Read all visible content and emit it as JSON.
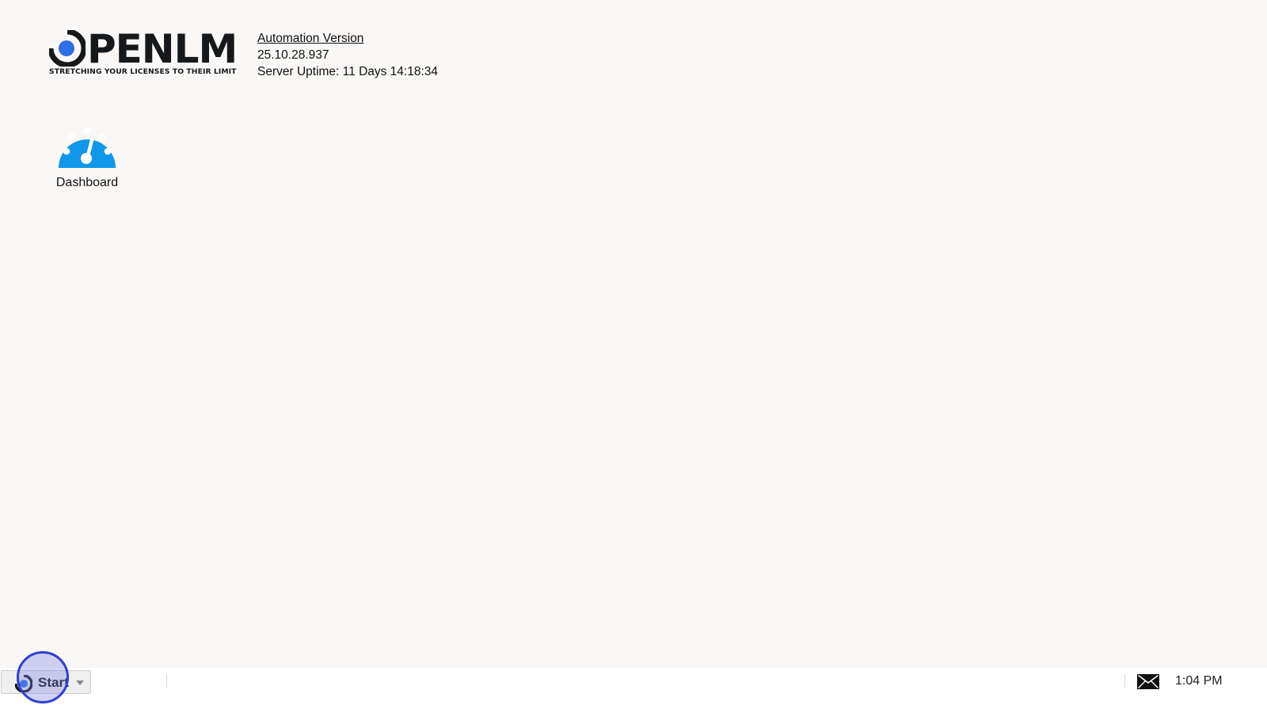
{
  "header": {
    "logo_text": "PENLM",
    "logo_tagline": "STRETCHING YOUR LICENSES TO THEIR LIMIT",
    "version_link": "Automation Version",
    "version_number": "25.10.28.937",
    "server_uptime": "Server Uptime: 11 Days 14:18:34"
  },
  "desktop": {
    "shortcuts": [
      {
        "label": "Dashboard",
        "icon": "dashboard-gauge-icon"
      }
    ]
  },
  "taskbar": {
    "start_label": "Start",
    "clock": "1:04 PM",
    "tray_icons": [
      "mail-icon"
    ]
  },
  "colors": {
    "background": "#faf8f6",
    "dashboard_icon": "#1197e8",
    "logo_dot": "#2e6ee6",
    "logo_text": "#15191b",
    "highlight_ring": "#2f3fcf"
  }
}
